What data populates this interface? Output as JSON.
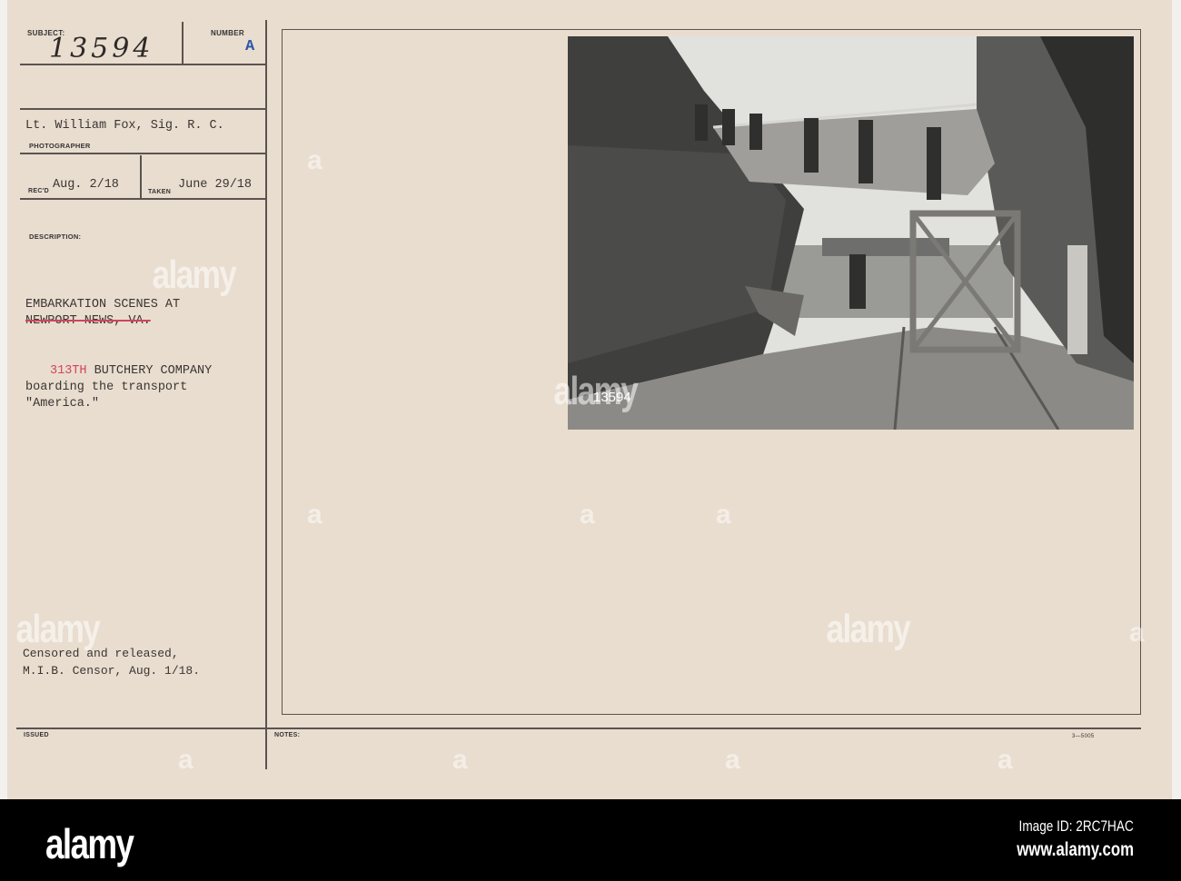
{
  "card": {
    "subject_label": "SUBJECT:",
    "subject_number": "13594",
    "number_label": "NUMBER",
    "number_value": "A",
    "photographer_name": "Lt. William Fox, Sig. R. C.",
    "photographer_label": "PHOTOGRAPHER",
    "recd_label": "REC'D",
    "recd_date": "Aug. 2/18",
    "taken_label": "TAKEN",
    "taken_date": "June 29/18",
    "description_label": "DESCRIPTION:",
    "description_line1": "EMBARKATION SCENES AT",
    "description_line2_struck": "NEWPORT NEWS, VA.",
    "unit_red": "313TH",
    "unit_rest": " BUTCHERY COMPANY",
    "description_line4": "boarding the transport",
    "description_line5": "\"America.\"",
    "censor_line1": "Censored and released,",
    "censor_line2": "M.I.B. Censor, Aug. 1/18.",
    "issued_label": "ISSUED",
    "notes_label": "NOTES:",
    "form_number": "3—5005",
    "photo_mark": "13594"
  },
  "watermark": {
    "brand": "alamy",
    "letter": "a"
  },
  "footer": {
    "logo": "alamy",
    "image_id": "Image ID: 2RC7HAC",
    "url": "www.alamy.com"
  }
}
